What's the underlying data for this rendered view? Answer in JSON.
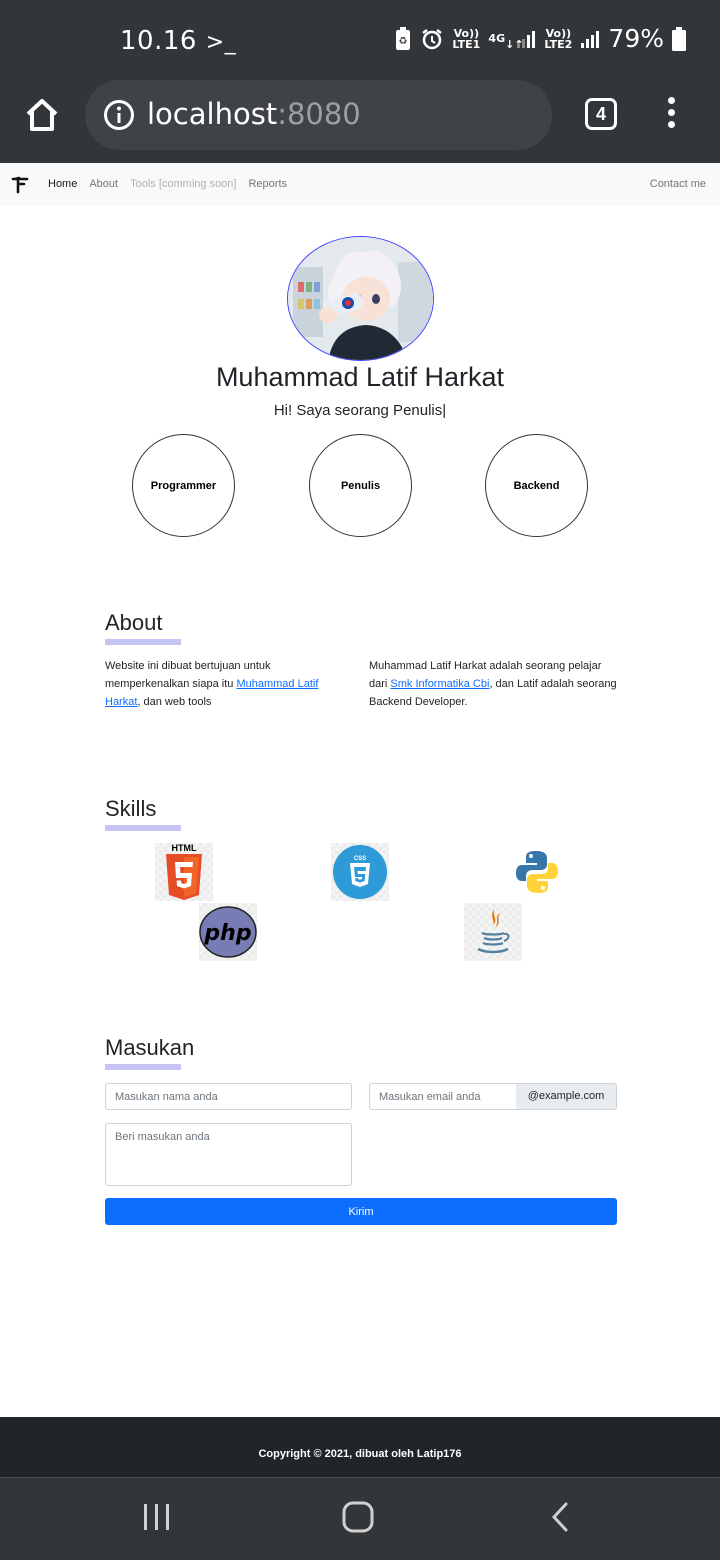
{
  "status_bar": {
    "time": "10.16",
    "network_1": "Vo)) LTE1",
    "network_type": "4G",
    "network_2": "Vo)) LTE2",
    "battery": "79%"
  },
  "browser": {
    "host": "localhost",
    "port": ":8080",
    "tab_count": "4"
  },
  "navbar": {
    "links": [
      "Home",
      "About",
      "Tools [comming soon]",
      "Reports"
    ],
    "contact": "Contact me"
  },
  "hero": {
    "name": "Muhammad Latif Harkat",
    "subtitle": "Hi! Saya seorang Penulis|",
    "roles": [
      "Programmer",
      "Penulis",
      "Backend"
    ]
  },
  "about": {
    "title": "About",
    "left": {
      "before": "Website ini dibuat bertujuan untuk memperkenalkan siapa itu ",
      "link": "Muhammad Latif Harkat",
      "after": ", dan web tools"
    },
    "right": {
      "before": "Muhammad Latif Harkat adalah seorang pelajar dari ",
      "link": "Smk Informatika Cbi",
      "after": ", dan Latif adalah seorang Backend Developer."
    }
  },
  "skills": {
    "title": "Skills",
    "items": [
      "html5-logo",
      "css3-logo",
      "python-logo",
      "php-logo",
      "java-logo"
    ],
    "html_badge": "HTML",
    "css_badge": "CSS",
    "php_text": "php"
  },
  "feedback": {
    "title": "Masukan",
    "name_placeholder": "Masukan nama anda",
    "email_placeholder": "Masukan email anda",
    "email_suffix": "@example.com",
    "message_placeholder": "Beri masukan anda",
    "submit": "Kirim"
  },
  "footer": {
    "copyright": "Copyright © 2021, dibuat oleh Latip176"
  },
  "colors": {
    "primary": "#0d6efd",
    "underline": "#c4c4f5",
    "footer_bg": "#212529",
    "chrome_bg": "#333639"
  }
}
